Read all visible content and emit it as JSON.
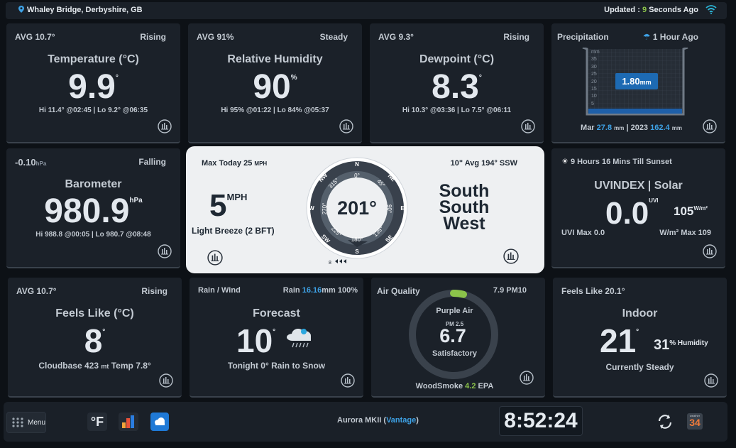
{
  "header": {
    "location": "Whaley Bridge, Derbyshire, GB",
    "updated_prefix": "Updated : ",
    "updated_num": "9",
    "updated_suffix": " Seconds Ago"
  },
  "temperature": {
    "avg": "AVG 10.7°",
    "trend": "Rising",
    "title": "Temperature (°C)",
    "value": "9.9",
    "unit": "°",
    "hilo": "Hi 11.4° @02:45 | Lo 9.2° @06:35"
  },
  "humidity": {
    "avg": "AVG 91%",
    "trend": "Steady",
    "title": "Relative Humidity",
    "value": "90",
    "unit": "%",
    "hilo": "Hi 95% @01:22 | Lo 84% @05:37"
  },
  "dewpoint": {
    "avg": "AVG 9.3°",
    "trend": "Rising",
    "title": "Dewpoint (°C)",
    "value": "8.3",
    "unit": "°",
    "hilo": "Hi 10.3° @03:36 | Lo 7.5° @06:11"
  },
  "precipitation": {
    "title": "Precipitation",
    "ago": "1 Hour Ago",
    "value": "1.80",
    "unit": "mm",
    "scale_unit": "mm",
    "scale": [
      "35",
      "30",
      "25",
      "20",
      "15",
      "10",
      "5"
    ],
    "mar_label": "Mar",
    "mar_value": "27.8",
    "mar_unit": "mm",
    "sep": "|",
    "year_label": "2023",
    "year_value": "162.4",
    "year_unit": "mm"
  },
  "barometer": {
    "change": "-0.10",
    "change_unit": "hPa",
    "trend": "Falling",
    "title": "Barometer",
    "value": "980.9",
    "unit": "hPa",
    "hilo": "Hi 988.8 @00:05 | Lo 980.7 @08:48"
  },
  "wind": {
    "max_label": "Max Today",
    "max_value": "25",
    "max_unit": "MPH",
    "speed": "5",
    "speed_unit": "MPH",
    "desc": "Light Breeze (2 BFT)",
    "avg_text": "10\" Avg 194° SSW",
    "direction": "201°",
    "dir_line1": "South",
    "dir_line2": "South",
    "dir_line3": "West",
    "compass": {
      "N": "N",
      "NE": "NE",
      "E": "E",
      "SE": "SE",
      "S": "S",
      "SW": "SW",
      "W": "W",
      "NW": "NW",
      "d0": "0°",
      "d45": "45°",
      "d90": "90°",
      "d135": "135°",
      "d180": "180°",
      "d225": "225°",
      "d270": "270°",
      "d315": "315°"
    },
    "bearing_deg": 201,
    "gust_marker": "8"
  },
  "solar": {
    "sunset": "9 Hours 16 Mins Till Sunset",
    "title": "UVINDEX | Solar",
    "uv": "0.0",
    "uv_unit": "UVI",
    "solar": "105",
    "solar_unit": "W/m²",
    "uv_max": "UVI Max 0.0",
    "solar_max": "W/m² Max 109"
  },
  "feels": {
    "avg": "AVG 10.7°",
    "trend": "Rising",
    "title": "Feels Like (°C)",
    "value": "8",
    "unit": "°",
    "cloudbase_label": "Cloudbase",
    "cloudbase_value": "423",
    "cloudbase_unit": "mt",
    "temp_label": "Temp",
    "temp_value": "7.8°"
  },
  "forecast": {
    "left": "Rain / Wind",
    "rain_label": "Rain",
    "rain_value": "16.16",
    "rain_unit": "mm 100%",
    "title": "Forecast",
    "value": "10",
    "unit": "°",
    "text": "Tonight 0° Rain to Snow"
  },
  "air": {
    "title": "Air Quality",
    "pm10": "7.9 PM10",
    "source": "Purple Air",
    "pm_label": "PM 2.5",
    "value": "6.7",
    "status": "Satisfactory",
    "woodsmoke_label": "WoodSmoke",
    "woodsmoke_value": "4.2",
    "woodsmoke_unit": "EPA",
    "level_fraction": 0.03
  },
  "indoor": {
    "feels": "Feels Like 20.1°",
    "title": "Indoor",
    "value": "21",
    "unit": "°",
    "humidity": "31",
    "humidity_unit": "% Humidity",
    "status": "Currently Steady"
  },
  "bottom": {
    "menu": "Menu",
    "unit_toggle": "°F",
    "station_prefix": "Aurora MKII (",
    "station_brand": "Vantage",
    "station_suffix": ")",
    "clock": "8:52:24",
    "calendar_label": "weather",
    "calendar_day": "34"
  },
  "colors": {
    "accent_blue": "#3ea2e6",
    "accent_green": "#8bc34a",
    "card": "#1b2129",
    "bg": "#0d1116"
  }
}
